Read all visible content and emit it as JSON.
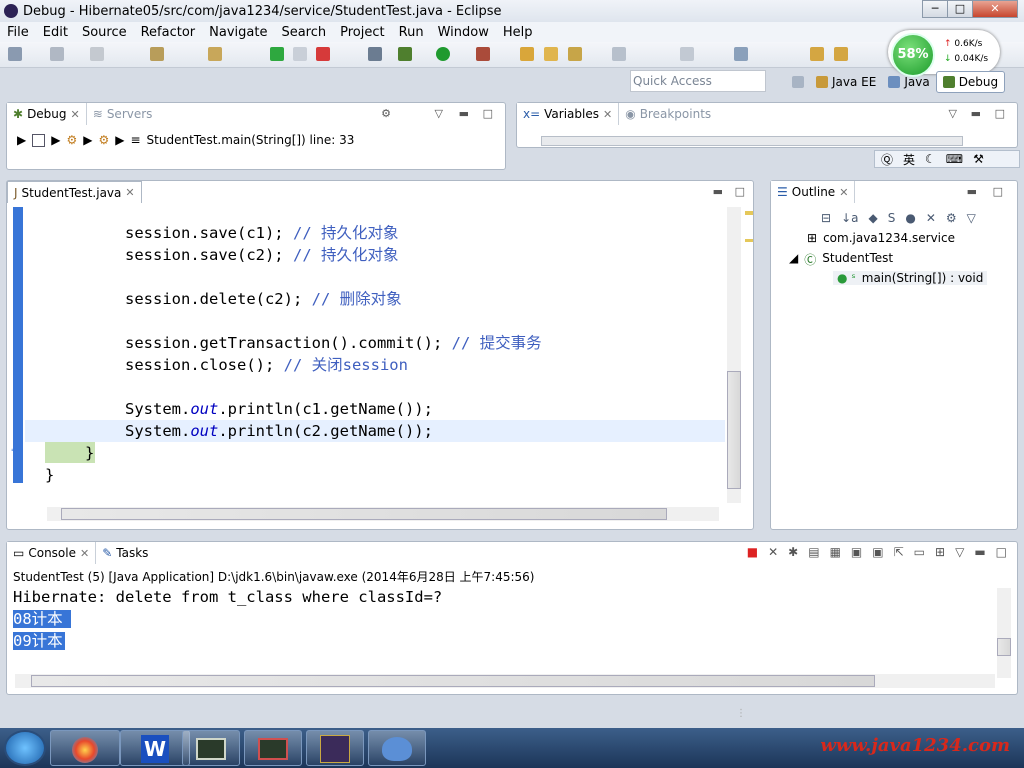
{
  "window": {
    "title": "Debug - Hibernate05/src/com/java1234/service/StudentTest.java - Eclipse",
    "min": "─",
    "max": "□",
    "close": "✕"
  },
  "menu": [
    "File",
    "Edit",
    "Source",
    "Refactor",
    "Navigate",
    "Search",
    "Project",
    "Run",
    "Window",
    "Help"
  ],
  "quick_access": {
    "placeholder": "Quick Access"
  },
  "perspectives": [
    {
      "label": "Java EE"
    },
    {
      "label": "Java"
    },
    {
      "label": "Debug"
    }
  ],
  "network": {
    "percent": "58%",
    "up": "0.6K/s",
    "down": "0.04K/s"
  },
  "debug_view": {
    "tabs": [
      "Debug",
      "Servers"
    ],
    "frame": "StudentTest.main(String[]) line: 33"
  },
  "variables_view": {
    "tabs": [
      "Variables",
      "Breakpoints"
    ]
  },
  "ime": {
    "lang": "英"
  },
  "editor": {
    "tab": "StudentTest.java",
    "lines": [
      {
        "code": "session.save(c1); ",
        "comment": "// 持久化对象"
      },
      {
        "code": "session.save(c2); ",
        "comment": "// 持久化对象"
      },
      {
        "code": "session.delete(c2); ",
        "comment": "// 删除对象"
      },
      {
        "code": "session.getTransaction().commit(); ",
        "comment": "// 提交事务"
      },
      {
        "code": "session.close(); ",
        "comment": "// 关闭session"
      },
      {
        "pre": "System.",
        "it": "out",
        "post": ".println(c1.getName());"
      },
      {
        "pre": "System.",
        "it": "out",
        "post": ".println(c2.getName());"
      },
      {
        "code": "}"
      },
      {
        "code": "}"
      }
    ]
  },
  "outline": {
    "tab": "Outline",
    "items": [
      "com.java1234.service",
      "StudentTest",
      "main(String[]) : void"
    ]
  },
  "console": {
    "tabs": [
      "Console",
      "Tasks"
    ],
    "header": "StudentTest (5) [Java Application] D:\\jdk1.6\\bin\\javaw.exe (2014年6月28日 上午7:45:56)",
    "lines": [
      "Hibernate: delete from t_class where classId=?",
      "08计本",
      "09计本"
    ]
  },
  "watermark": "www.java1234.com",
  "colors": {
    "accent": "#3875d7",
    "comment": "#3f5fbf",
    "field": "#0000c0",
    "selection": "#3875d7"
  }
}
